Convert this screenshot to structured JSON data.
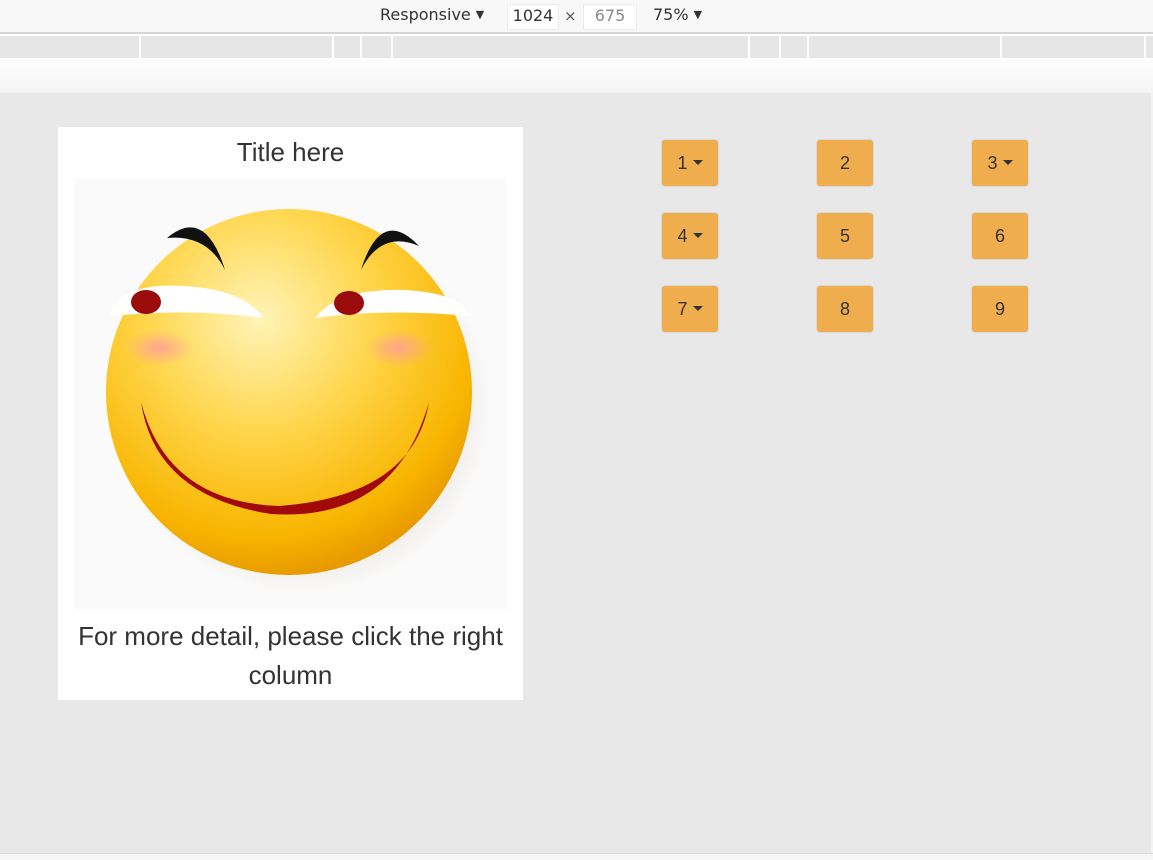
{
  "devtools": {
    "mode": "Responsive",
    "width": "1024",
    "times": "×",
    "height": "675",
    "zoom": "75%"
  },
  "card": {
    "title": "Title here",
    "caption": "For more detail, please click the right column",
    "image_icon": "smiley-face-icon"
  },
  "buttons": [
    {
      "label": "1",
      "dropdown": true
    },
    {
      "label": "2",
      "dropdown": false
    },
    {
      "label": "3",
      "dropdown": true
    },
    {
      "label": "4",
      "dropdown": true
    },
    {
      "label": "5",
      "dropdown": false
    },
    {
      "label": "6",
      "dropdown": false
    },
    {
      "label": "7",
      "dropdown": true
    },
    {
      "label": "8",
      "dropdown": false
    },
    {
      "label": "9",
      "dropdown": false
    }
  ],
  "colors": {
    "button": "#f0ad4e",
    "viewport": "#e8e8e8"
  }
}
